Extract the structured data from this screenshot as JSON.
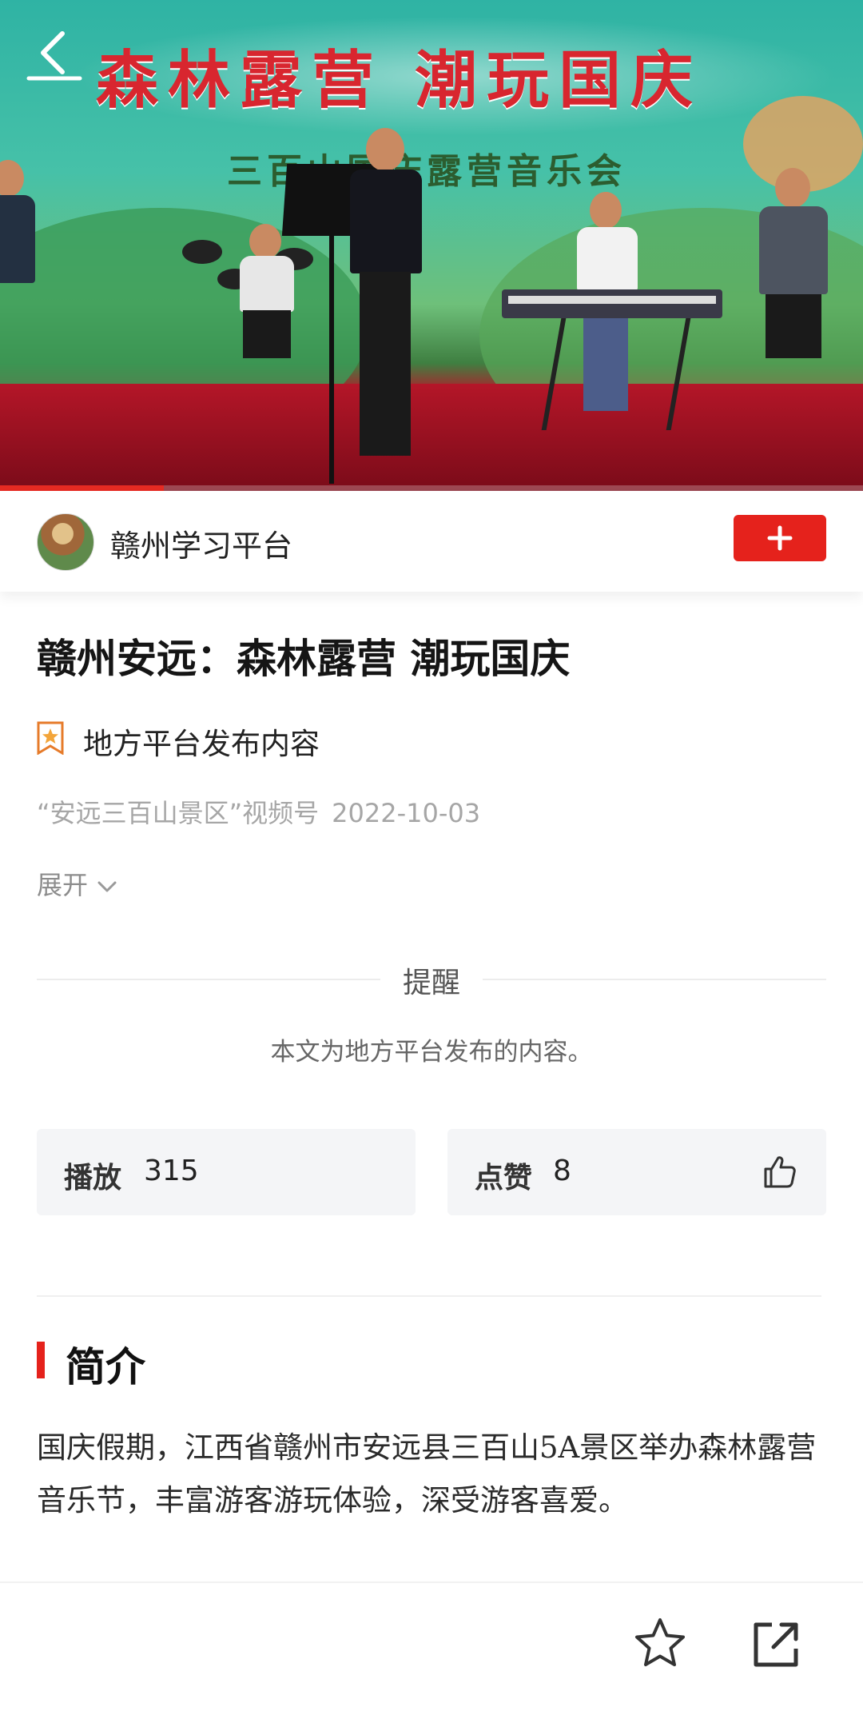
{
  "video": {
    "banner_title": "森林露营  潮玩国庆",
    "banner_subtitle": "三百山国庆露营音乐会",
    "progress_fraction": 0.19,
    "accent_color": "#e52a22"
  },
  "account": {
    "name": "赣州学习平台",
    "follow_icon": "plus-icon"
  },
  "article": {
    "title": "赣州安远：森林露营  潮玩国庆",
    "source_label": "地方平台发布内容",
    "meta_source": "“安远三百山景区”视频号",
    "meta_date": "2022-10-03",
    "expand_label": "展开"
  },
  "reminder": {
    "title": "提醒",
    "text": "本文为地方平台发布的内容。"
  },
  "stats": {
    "play_label": "播放",
    "play_count": "315",
    "like_label": "点赞",
    "like_count": "8"
  },
  "intro": {
    "heading": "简介",
    "text": "国庆假期，江西省赣州市安远县三百山5A景区举办森林露营音乐节，丰富游客游玩体验，深受游客喜爱。"
  },
  "bottom_bar": {
    "icons": [
      "star-icon",
      "share-icon"
    ]
  }
}
